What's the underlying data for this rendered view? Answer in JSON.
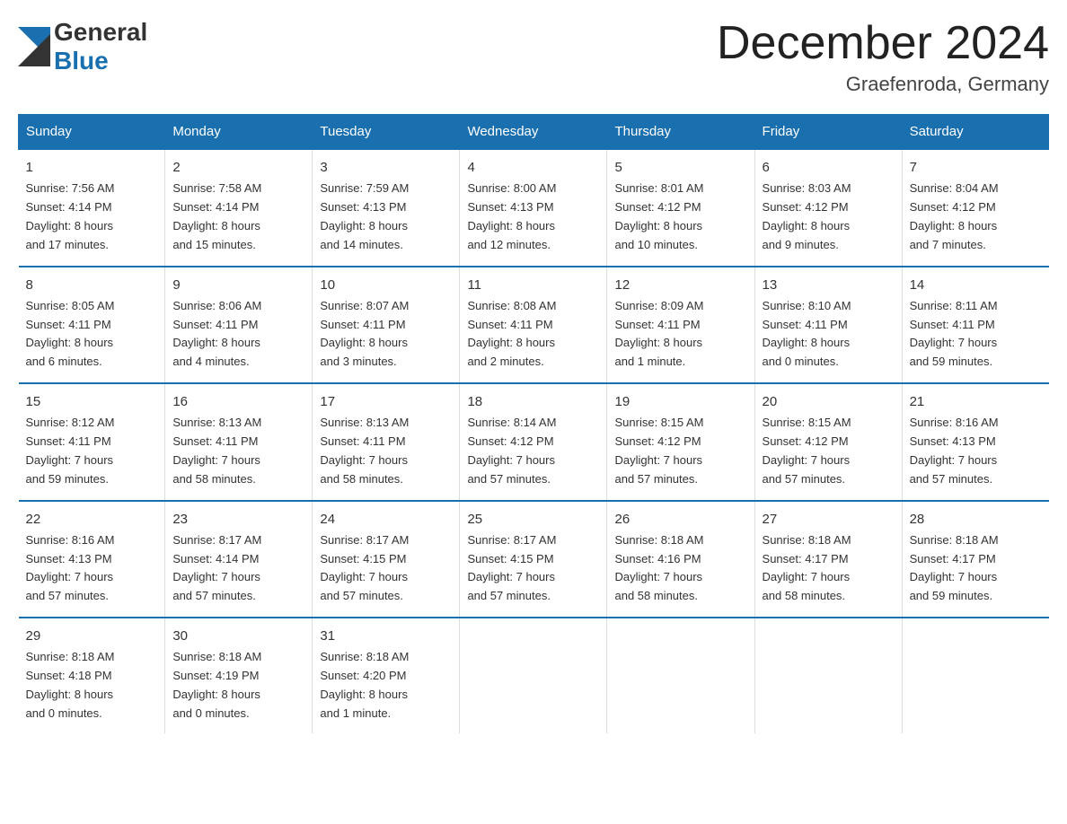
{
  "logo": {
    "general": "General",
    "blue": "Blue"
  },
  "title": "December 2024",
  "subtitle": "Graefenroda, Germany",
  "days_of_week": [
    "Sunday",
    "Monday",
    "Tuesday",
    "Wednesday",
    "Thursday",
    "Friday",
    "Saturday"
  ],
  "weeks": [
    [
      {
        "day": "1",
        "info": "Sunrise: 7:56 AM\nSunset: 4:14 PM\nDaylight: 8 hours\nand 17 minutes."
      },
      {
        "day": "2",
        "info": "Sunrise: 7:58 AM\nSunset: 4:14 PM\nDaylight: 8 hours\nand 15 minutes."
      },
      {
        "day": "3",
        "info": "Sunrise: 7:59 AM\nSunset: 4:13 PM\nDaylight: 8 hours\nand 14 minutes."
      },
      {
        "day": "4",
        "info": "Sunrise: 8:00 AM\nSunset: 4:13 PM\nDaylight: 8 hours\nand 12 minutes."
      },
      {
        "day": "5",
        "info": "Sunrise: 8:01 AM\nSunset: 4:12 PM\nDaylight: 8 hours\nand 10 minutes."
      },
      {
        "day": "6",
        "info": "Sunrise: 8:03 AM\nSunset: 4:12 PM\nDaylight: 8 hours\nand 9 minutes."
      },
      {
        "day": "7",
        "info": "Sunrise: 8:04 AM\nSunset: 4:12 PM\nDaylight: 8 hours\nand 7 minutes."
      }
    ],
    [
      {
        "day": "8",
        "info": "Sunrise: 8:05 AM\nSunset: 4:11 PM\nDaylight: 8 hours\nand 6 minutes."
      },
      {
        "day": "9",
        "info": "Sunrise: 8:06 AM\nSunset: 4:11 PM\nDaylight: 8 hours\nand 4 minutes."
      },
      {
        "day": "10",
        "info": "Sunrise: 8:07 AM\nSunset: 4:11 PM\nDaylight: 8 hours\nand 3 minutes."
      },
      {
        "day": "11",
        "info": "Sunrise: 8:08 AM\nSunset: 4:11 PM\nDaylight: 8 hours\nand 2 minutes."
      },
      {
        "day": "12",
        "info": "Sunrise: 8:09 AM\nSunset: 4:11 PM\nDaylight: 8 hours\nand 1 minute."
      },
      {
        "day": "13",
        "info": "Sunrise: 8:10 AM\nSunset: 4:11 PM\nDaylight: 8 hours\nand 0 minutes."
      },
      {
        "day": "14",
        "info": "Sunrise: 8:11 AM\nSunset: 4:11 PM\nDaylight: 7 hours\nand 59 minutes."
      }
    ],
    [
      {
        "day": "15",
        "info": "Sunrise: 8:12 AM\nSunset: 4:11 PM\nDaylight: 7 hours\nand 59 minutes."
      },
      {
        "day": "16",
        "info": "Sunrise: 8:13 AM\nSunset: 4:11 PM\nDaylight: 7 hours\nand 58 minutes."
      },
      {
        "day": "17",
        "info": "Sunrise: 8:13 AM\nSunset: 4:11 PM\nDaylight: 7 hours\nand 58 minutes."
      },
      {
        "day": "18",
        "info": "Sunrise: 8:14 AM\nSunset: 4:12 PM\nDaylight: 7 hours\nand 57 minutes."
      },
      {
        "day": "19",
        "info": "Sunrise: 8:15 AM\nSunset: 4:12 PM\nDaylight: 7 hours\nand 57 minutes."
      },
      {
        "day": "20",
        "info": "Sunrise: 8:15 AM\nSunset: 4:12 PM\nDaylight: 7 hours\nand 57 minutes."
      },
      {
        "day": "21",
        "info": "Sunrise: 8:16 AM\nSunset: 4:13 PM\nDaylight: 7 hours\nand 57 minutes."
      }
    ],
    [
      {
        "day": "22",
        "info": "Sunrise: 8:16 AM\nSunset: 4:13 PM\nDaylight: 7 hours\nand 57 minutes."
      },
      {
        "day": "23",
        "info": "Sunrise: 8:17 AM\nSunset: 4:14 PM\nDaylight: 7 hours\nand 57 minutes."
      },
      {
        "day": "24",
        "info": "Sunrise: 8:17 AM\nSunset: 4:15 PM\nDaylight: 7 hours\nand 57 minutes."
      },
      {
        "day": "25",
        "info": "Sunrise: 8:17 AM\nSunset: 4:15 PM\nDaylight: 7 hours\nand 57 minutes."
      },
      {
        "day": "26",
        "info": "Sunrise: 8:18 AM\nSunset: 4:16 PM\nDaylight: 7 hours\nand 58 minutes."
      },
      {
        "day": "27",
        "info": "Sunrise: 8:18 AM\nSunset: 4:17 PM\nDaylight: 7 hours\nand 58 minutes."
      },
      {
        "day": "28",
        "info": "Sunrise: 8:18 AM\nSunset: 4:17 PM\nDaylight: 7 hours\nand 59 minutes."
      }
    ],
    [
      {
        "day": "29",
        "info": "Sunrise: 8:18 AM\nSunset: 4:18 PM\nDaylight: 8 hours\nand 0 minutes."
      },
      {
        "day": "30",
        "info": "Sunrise: 8:18 AM\nSunset: 4:19 PM\nDaylight: 8 hours\nand 0 minutes."
      },
      {
        "day": "31",
        "info": "Sunrise: 8:18 AM\nSunset: 4:20 PM\nDaylight: 8 hours\nand 1 minute."
      },
      {
        "day": "",
        "info": ""
      },
      {
        "day": "",
        "info": ""
      },
      {
        "day": "",
        "info": ""
      },
      {
        "day": "",
        "info": ""
      }
    ]
  ]
}
